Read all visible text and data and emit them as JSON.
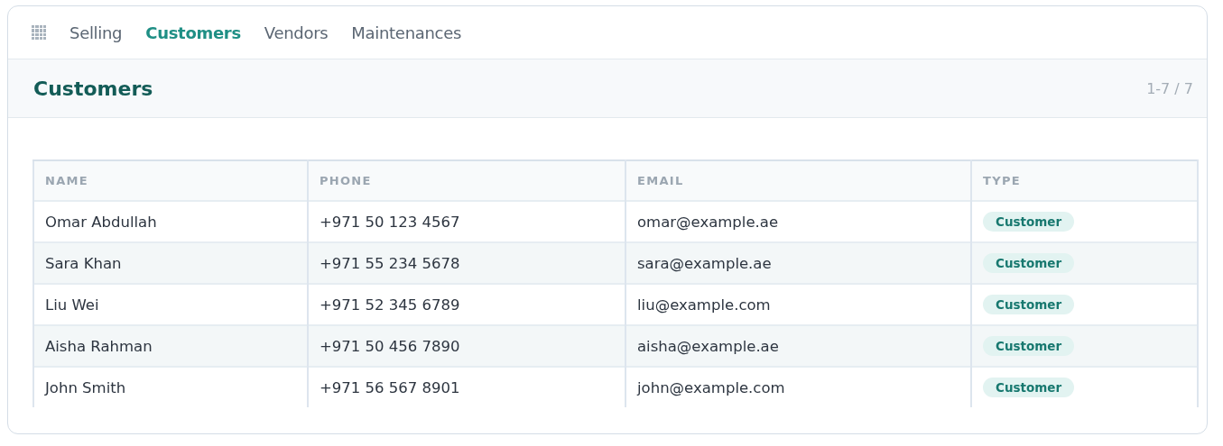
{
  "nav": {
    "tabs": [
      {
        "label": "Selling",
        "selected": false
      },
      {
        "label": "Customers",
        "selected": true
      },
      {
        "label": "Vendors",
        "selected": false
      },
      {
        "label": "Maintenances",
        "selected": false
      }
    ]
  },
  "header": {
    "title": "Customers",
    "pager": "1-7 / 7"
  },
  "table": {
    "columns": [
      "NAME",
      "PHONE",
      "EMAIL",
      "TYPE"
    ],
    "rows": [
      {
        "name": "Omar Abdullah",
        "phone": "+971 50 123 4567",
        "email": "omar@example.ae",
        "type": "Customer"
      },
      {
        "name": "Sara Khan",
        "phone": "+971 55 234 5678",
        "email": "sara@example.ae",
        "type": "Customer"
      },
      {
        "name": "Liu Wei",
        "phone": "+971 52 345 6789",
        "email": "liu@example.com",
        "type": "Customer"
      },
      {
        "name": "Aisha Rahman",
        "phone": "+971 50 456 7890",
        "email": "aisha@example.ae",
        "type": "Customer"
      },
      {
        "name": "John Smith",
        "phone": "+971 56 567 8901",
        "email": "john@example.com",
        "type": "Customer"
      }
    ]
  }
}
